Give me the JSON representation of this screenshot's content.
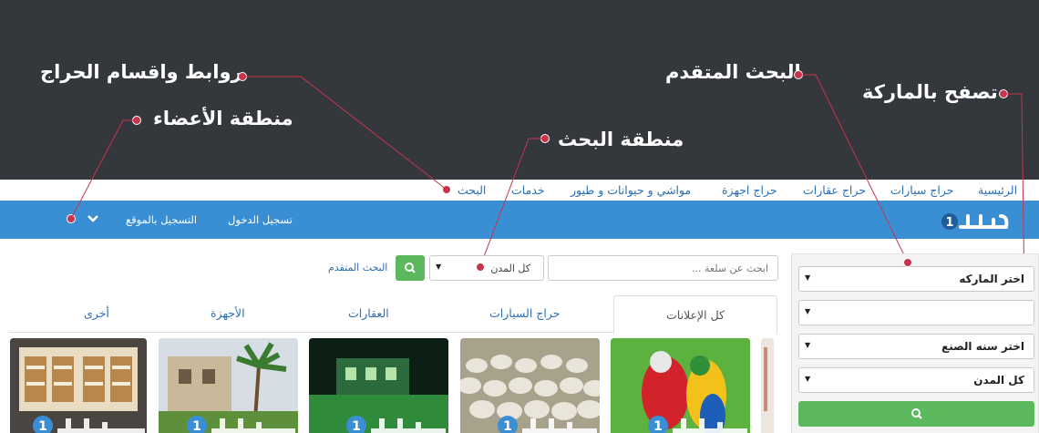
{
  "annotations": {
    "links_sections": "روابط واقسام الحراج",
    "members_area": "منطقة الأعضاء",
    "search_area": "منطقة البحث",
    "advanced_search": "البحث المتقدم",
    "browse_brand": "تصفح بالماركة"
  },
  "top_links": [
    "الرئيسية",
    "حراج سيارات",
    "حراج عقارات",
    "حراج اجهزة",
    "مواشي و حيوانات و طيور",
    "خدمات",
    "البحث"
  ],
  "header": {
    "logo_text": "حراج 1",
    "login": "تسجيل الدخول",
    "register": "التسجيل بالموقع"
  },
  "search": {
    "placeholder": "ابحث عن سلعة ...",
    "city_value": "كل المدن",
    "advanced_link": "البحث المتقدم"
  },
  "sidebar": {
    "brand": "اختر الماركه",
    "model": "",
    "year": "اختر سنه الصنع",
    "city": "كل المدن"
  },
  "tabs": [
    "كل الإعلانات",
    "حراج السيارات",
    "العقارات",
    "الأجهزة",
    "أخرى"
  ],
  "colors": {
    "banner": "#34373c",
    "accent_red": "#c7344b",
    "header_blue": "#3a8fd4",
    "link_blue": "#2b6fb3",
    "green": "#5cb85c"
  },
  "thumbnails": [
    {
      "subject": "parrots",
      "icon": "parrot-photo"
    },
    {
      "subject": "sheep flock",
      "icon": "sheep-photo"
    },
    {
      "subject": "house at night",
      "icon": "villa-photo"
    },
    {
      "subject": "palm trees house",
      "icon": "palm-house-photo"
    },
    {
      "subject": "shop interior",
      "icon": "shop-photo"
    }
  ]
}
